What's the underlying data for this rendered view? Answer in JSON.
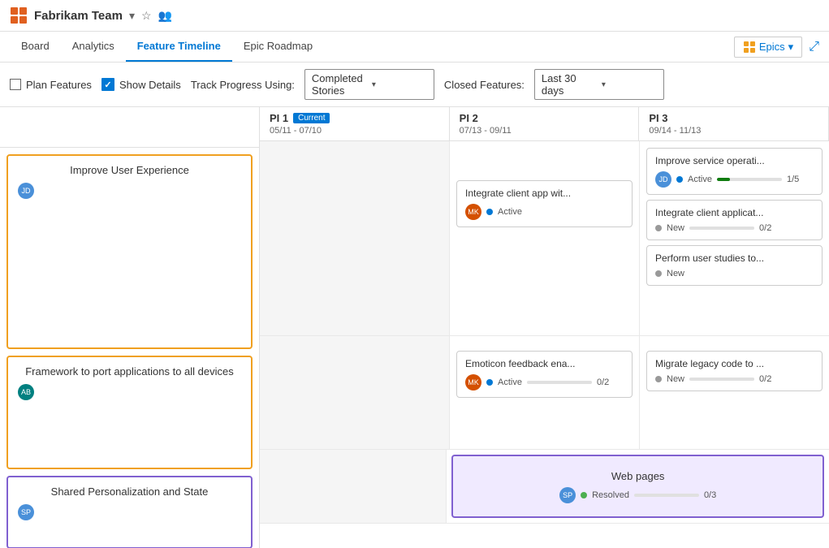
{
  "app": {
    "icon_label": "Fabrikam grid icon",
    "team_name": "Fabrikam Team",
    "dropdown_icon": "▾",
    "star_icon": "☆",
    "person_icon": "👤"
  },
  "nav": {
    "tabs": [
      {
        "id": "board",
        "label": "Board",
        "active": false
      },
      {
        "id": "analytics",
        "label": "Analytics",
        "active": false
      },
      {
        "id": "feature-timeline",
        "label": "Feature Timeline",
        "active": true
      },
      {
        "id": "epic-roadmap",
        "label": "Epic Roadmap",
        "active": false
      }
    ],
    "epics_button": "Epics",
    "expand_icon": "⤢"
  },
  "toolbar": {
    "plan_features_label": "Plan Features",
    "show_details_label": "Show Details",
    "track_progress_label": "Track Progress Using:",
    "completed_stories_value": "Completed Stories",
    "closed_features_label": "Closed Features:",
    "last_30_days_value": "Last 30 days"
  },
  "pi_headers": [
    {
      "id": "pi1",
      "label": "PI 1",
      "badge": "Current",
      "dates": "05/11 - 07/10"
    },
    {
      "id": "pi2",
      "label": "PI 2",
      "dates": "07/13 - 09/11"
    },
    {
      "id": "pi3",
      "label": "PI 3",
      "dates": "09/14 - 11/13"
    }
  ],
  "epics": [
    {
      "id": "epic1",
      "title": "Improve User Experience",
      "border_color": "#f0a020",
      "avatar_initials": "JD",
      "avatar_color": "#4a90d9",
      "pi1_features": [],
      "pi2_features": [
        {
          "title": "Integrate client app wit...",
          "status": "Active",
          "status_type": "active",
          "avatar_initials": "MK",
          "avatar_color": "#d45000",
          "progress": null,
          "count": null
        }
      ],
      "pi3_features": [
        {
          "title": "Improve service operati...",
          "status": "Active",
          "status_type": "active",
          "avatar_initials": "JD",
          "avatar_color": "#4a90d9",
          "progress": 20,
          "progress_color": "green",
          "count": "1/5"
        },
        {
          "title": "Integrate client applicat...",
          "status": "New",
          "status_type": "new",
          "avatar_initials": null,
          "progress": 0,
          "progress_color": "blue",
          "count": "0/2"
        },
        {
          "title": "Perform user studies to...",
          "status": "New",
          "status_type": "new",
          "avatar_initials": null,
          "progress": null,
          "count": null
        }
      ]
    },
    {
      "id": "epic2",
      "title": "Framework to port applications to all devices",
      "border_color": "#f0a020",
      "avatar_initials": "AB",
      "avatar_color": "#008080",
      "pi1_features": [],
      "pi2_features": [
        {
          "title": "Emoticon feedback ena...",
          "status": "Active",
          "status_type": "active",
          "avatar_initials": "MK",
          "avatar_color": "#d45000",
          "progress": 0,
          "progress_color": "blue",
          "count": "0/2"
        }
      ],
      "pi3_features": [
        {
          "title": "Migrate legacy code to ...",
          "status": "New",
          "status_type": "new",
          "avatar_initials": null,
          "progress": 0,
          "progress_color": "blue",
          "count": "0/2"
        }
      ]
    },
    {
      "id": "epic3",
      "title": "Shared Personalization and State",
      "border_color": "#8060d0",
      "avatar_initials": "SP",
      "avatar_color": "#4a90d9",
      "has_wide_card": true,
      "wide_card_title": "Web pages",
      "wide_card_status": "Resolved",
      "wide_card_status_type": "resolved",
      "wide_card_avatar_initials": "SP",
      "wide_card_avatar_color": "#4a90d9",
      "wide_card_progress": 0,
      "wide_card_count": "0/3"
    }
  ]
}
